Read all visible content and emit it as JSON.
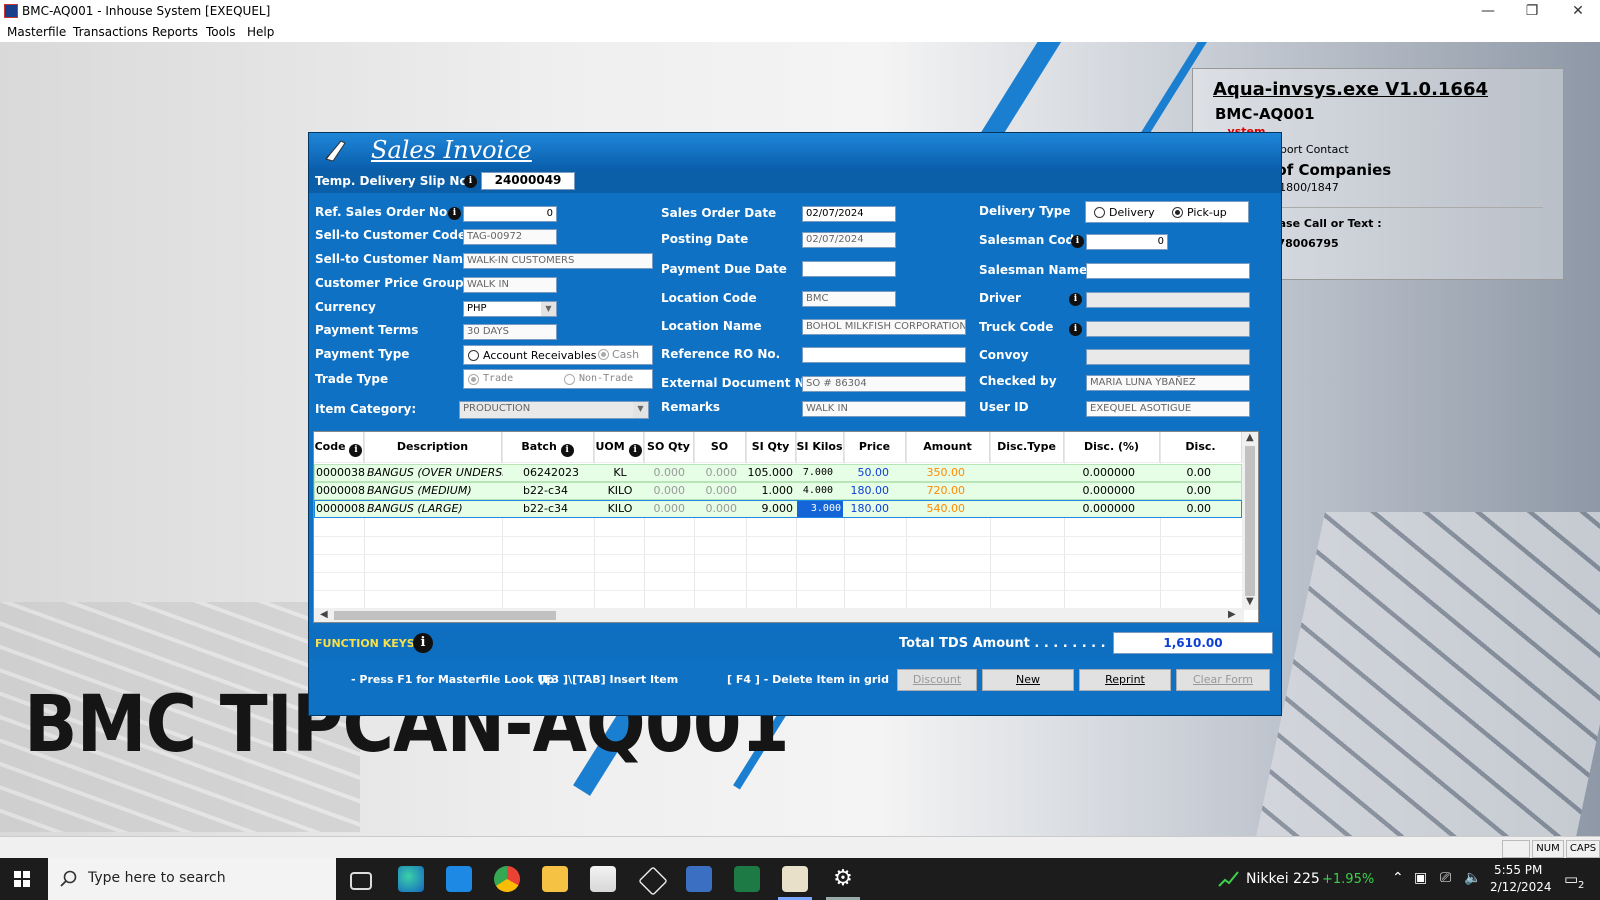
{
  "window": {
    "title": "BMC-AQ001 - Inhouse System [EXEQUEL]",
    "minimize_glyph": "—",
    "maximize_glyph": "❐",
    "close_glyph": "✕"
  },
  "menu": [
    "Masterfile",
    "Transactions",
    "Reports",
    "Tools",
    "Help"
  ],
  "background": {
    "big_text": "BMC TIPCAN-AQ001",
    "info_title": "Aqua-invsys.exe V1.0.1664",
    "info_code": "BMC-AQ001",
    "info_red": "...ystem",
    "info_support": "...s and Support Contact",
    "info_group": "...roup of Companies",
    "info_local": "...000 local 1800/1847",
    "info_call": "...ases Please Call or Text :",
    "info_phone": "...36 / 09178006795"
  },
  "invoice": {
    "title": "Sales Invoice",
    "tds_label": "Temp. Delivery Slip No.",
    "tds_value": "24000049",
    "left": {
      "ref_so_label": "Ref. Sales Order No.",
      "ref_so_value": "0",
      "cust_code_label": "Sell-to Customer Code",
      "cust_code_value": "TAG-00972",
      "cust_name_label": "Sell-to Customer Name",
      "cust_name_value": "WALK-IN CUSTOMERS",
      "price_group_label": "Customer Price Group",
      "price_group_value": "WALK IN",
      "currency_label": "Currency",
      "currency_value": "PHP",
      "terms_label": "Payment Terms",
      "terms_value": "30 DAYS",
      "pay_type_label": "Payment Type",
      "pay_type_opt1": "Account Receivables",
      "pay_type_opt2": "Cash",
      "trade_type_label": "Trade Type",
      "trade_opt1": "Trade",
      "trade_opt2": "Non-Trade",
      "item_cat_label": "Item Category:",
      "item_cat_value": "PRODUCTION"
    },
    "middle": {
      "so_date_label": "Sales Order Date",
      "so_date_value": "02/07/2024",
      "posting_label": "Posting Date",
      "posting_value": "02/07/2024",
      "due_label": "Payment Due Date",
      "due_value": "",
      "loc_code_label": "Location Code",
      "loc_code_value": "BMC",
      "loc_name_label": "Location Name",
      "loc_name_value": "BOHOL MILKFISH CORPORATION",
      "ref_ro_label": "Reference RO No.",
      "ref_ro_value": "",
      "ext_doc_label": "External Document No.",
      "ext_doc_value": "SO # 86304",
      "remarks_label": "Remarks",
      "remarks_value": "WALK IN"
    },
    "right": {
      "delivery_type_label": "Delivery Type",
      "delivery_opt1": "Delivery",
      "delivery_opt2": "Pick-up",
      "salesman_code_label": "Salesman Code",
      "salesman_code_value": "0",
      "salesman_name_label": "Salesman Name",
      "salesman_name_value": "",
      "driver_label": "Driver",
      "driver_value": "",
      "truck_label": "Truck Code",
      "truck_value": "",
      "convoy_label": "Convoy",
      "convoy_value": "",
      "checked_label": "Checked by",
      "checked_value": "MARIA LUNA YBAÑEZ",
      "user_label": "User ID",
      "user_value": "EXEQUEL ASOTIGUE"
    },
    "grid": {
      "headers": [
        "Code",
        "Description",
        "Batch",
        "UOM",
        "SO Qty",
        "SO Kilos",
        "SI Qty",
        "SI Kilos",
        "Price",
        "Amount",
        "Disc.Type",
        "Disc. (%)",
        "Disc. Amount"
      ],
      "rows": [
        {
          "code": "0000038",
          "desc": "BANGUS (OVER UNDERSIZ",
          "batch": "06242023",
          "uom": "KL",
          "so_qty": "0.000",
          "so_kilos": "0.000",
          "si_qty": "105.000",
          "si_kilos": "7.000",
          "price": "50.00",
          "amount": "350.00",
          "disc_type": "",
          "disc_pct": "0.000000",
          "disc_amt": "0.00"
        },
        {
          "code": "0000008",
          "desc": "BANGUS (MEDIUM)",
          "batch": "b22-c34",
          "uom": "KILO",
          "so_qty": "0.000",
          "so_kilos": "0.000",
          "si_qty": "1.000",
          "si_kilos": "4.000",
          "price": "180.00",
          "amount": "720.00",
          "disc_type": "",
          "disc_pct": "0.000000",
          "disc_amt": "0.00"
        },
        {
          "code": "0000008",
          "desc": "BANGUS (LARGE)",
          "batch": "b22-c34",
          "uom": "KILO",
          "so_qty": "0.000",
          "so_kilos": "0.000",
          "si_qty": "9.000",
          "si_kilos": "3.000",
          "price": "180.00",
          "amount": "540.00",
          "disc_type": "",
          "disc_pct": "0.000000",
          "disc_amt": "0.00"
        }
      ]
    },
    "function_keys_label": "FUNCTION KEYS:",
    "total_label": "Total TDS Amount . . . . . . . .",
    "total_value": "1,610.00",
    "hints": [
      "- Press F1 for Masterfile Look Up",
      "[F3 ]\\[TAB] Insert Item",
      "[ F4 ] - Delete Item in grid"
    ],
    "buttons": {
      "discount": "Discount",
      "new": "New",
      "reprint": "Reprint",
      "clear": "Clear Form"
    }
  },
  "statusbar": {
    "num": "NUM",
    "caps": "CAPS"
  },
  "taskbar": {
    "search_placeholder": "Type here to search",
    "stock_name": "Nikkei 225",
    "stock_change": "+1.95%",
    "time": "5:55 PM",
    "date": "2/12/2024",
    "notif_count": "2"
  },
  "colors": {
    "accent_blue": "#0e71c4",
    "row_green": "#e6fde6",
    "price_blue": "#0d3fd6",
    "amount_orange": "#ff8a00",
    "stock_green": "#3ad14a"
  }
}
